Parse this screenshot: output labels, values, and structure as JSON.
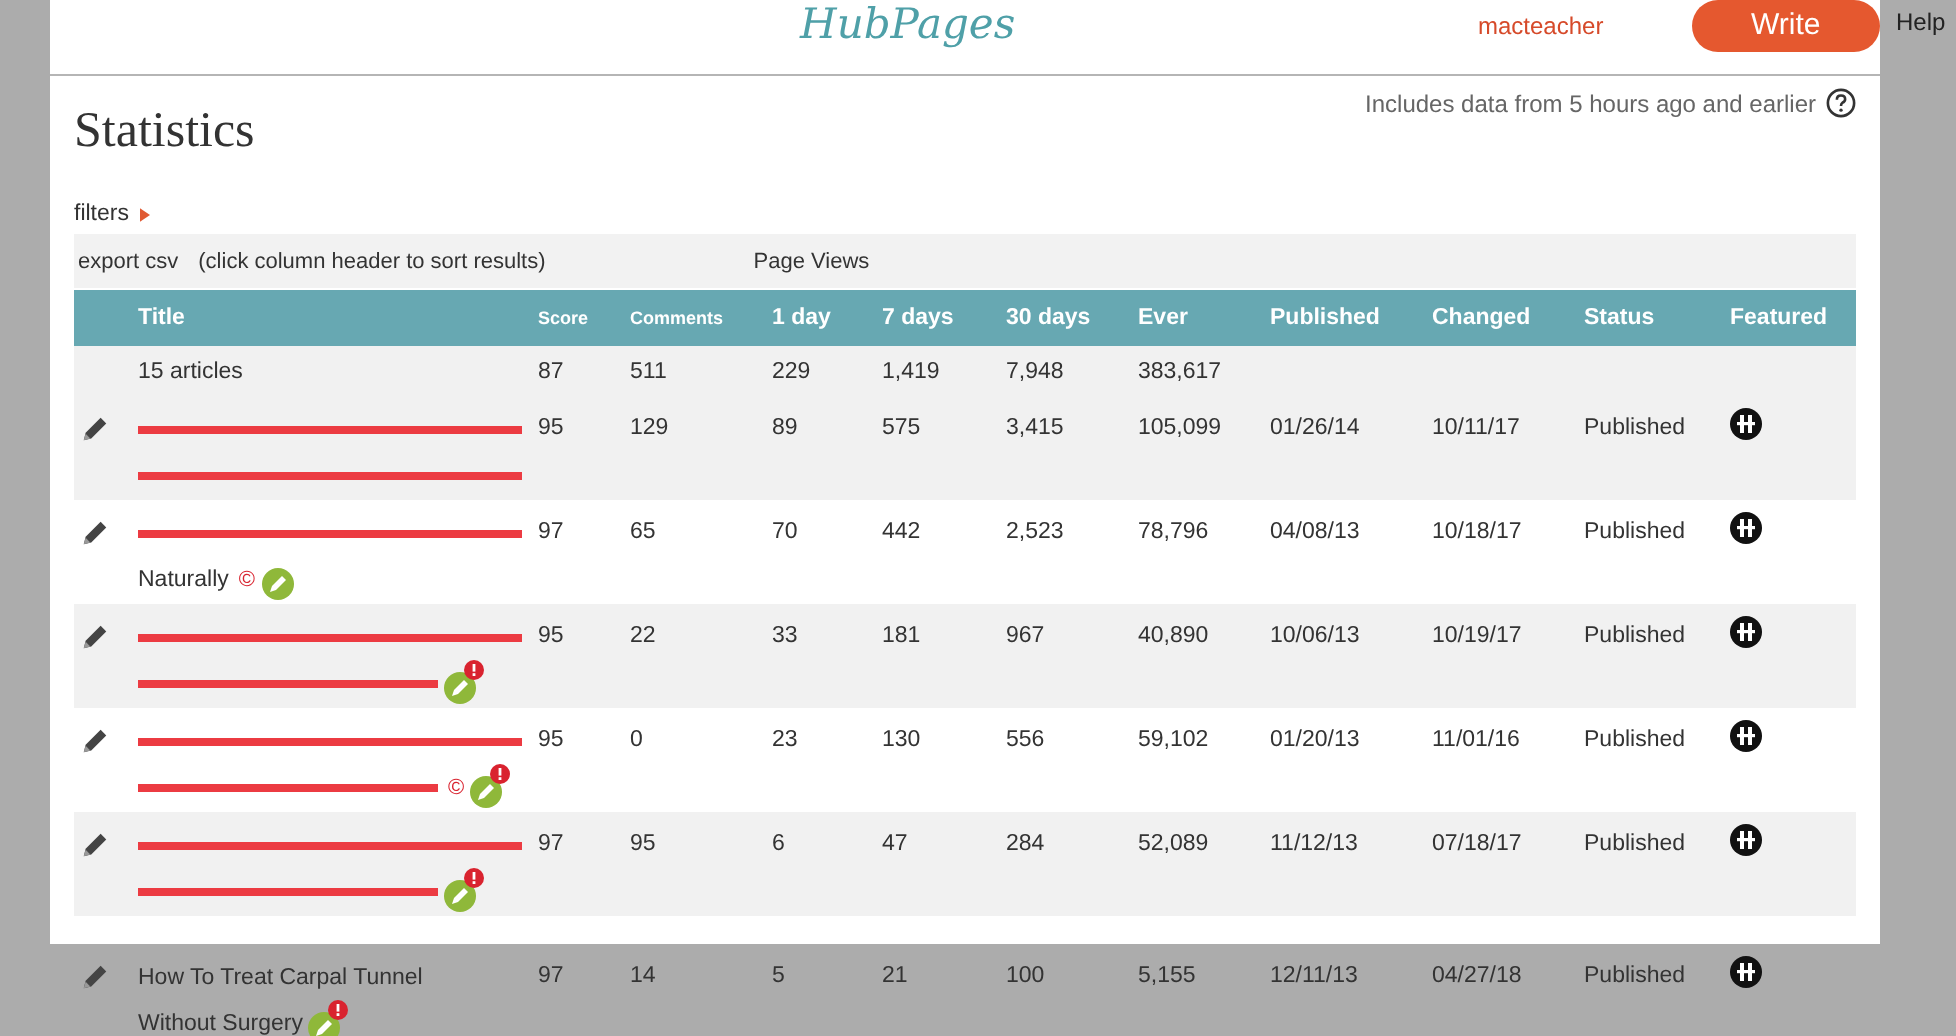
{
  "header": {
    "logo": "HubPages",
    "user": "macteacher",
    "write_button": "Write",
    "help": "Help"
  },
  "page": {
    "title": "Statistics",
    "data_note": "Includes data from 5 hours ago and earlier",
    "filters_label": "filters",
    "export_link": "export csv",
    "sort_hint": "(click column header to sort results)",
    "group_heading": "Page Views"
  },
  "table": {
    "columns": [
      "Title",
      "Score",
      "Comments",
      "1 day",
      "7 days",
      "30 days",
      "Ever",
      "Published",
      "Changed",
      "Status",
      "Featured"
    ],
    "summary": {
      "title": "15 articles",
      "score": "87",
      "comments": "511",
      "day1": "229",
      "days7": "1,419",
      "days30": "7,948",
      "ever": "383,617"
    },
    "rows": [
      {
        "title_lines": [
          {
            "redacted": true
          },
          {
            "redacted": true
          }
        ],
        "score": "95",
        "comments": "129",
        "day1": "89",
        "days7": "575",
        "days30": "3,415",
        "ever": "105,099",
        "published": "01/26/14",
        "changed": "10/11/17",
        "status": "Published",
        "featured": true
      },
      {
        "title_lines": [
          {
            "redacted": true
          },
          {
            "redacted": false,
            "text": "Naturally"
          }
        ],
        "copyright_mark": "©",
        "edit_badge": true,
        "score": "97",
        "comments": "65",
        "day1": "70",
        "days7": "442",
        "days30": "2,523",
        "ever": "78,796",
        "published": "04/08/13",
        "changed": "10/18/17",
        "status": "Published",
        "featured": true
      },
      {
        "title_lines": [
          {
            "redacted": true
          },
          {
            "redacted": true
          }
        ],
        "edit_badge": true,
        "badge_alert": true,
        "score": "95",
        "comments": "22",
        "day1": "33",
        "days7": "181",
        "days30": "967",
        "ever": "40,890",
        "published": "10/06/13",
        "changed": "10/19/17",
        "status": "Published",
        "featured": true
      },
      {
        "title_lines": [
          {
            "redacted": true
          },
          {
            "redacted": true
          }
        ],
        "copyright_mark": "©",
        "edit_badge": true,
        "badge_alert": true,
        "score": "95",
        "comments": "0",
        "day1": "23",
        "days7": "130",
        "days30": "556",
        "ever": "59,102",
        "published": "01/20/13",
        "changed": "11/01/16",
        "status": "Published",
        "featured": true
      },
      {
        "title_lines": [
          {
            "redacted": true
          },
          {
            "redacted": true
          }
        ],
        "edit_badge": true,
        "badge_alert": true,
        "score": "97",
        "comments": "95",
        "day1": "6",
        "days7": "47",
        "days30": "284",
        "ever": "52,089",
        "published": "11/12/13",
        "changed": "07/18/17",
        "status": "Published",
        "featured": true
      }
    ],
    "rows_below_panel": [
      {
        "title_lines": [
          {
            "redacted": false,
            "text": "How To Treat Carpal Tunnel"
          },
          {
            "redacted": false,
            "text": "Without Surgery"
          }
        ],
        "edit_badge": true,
        "badge_alert": true,
        "score": "97",
        "comments": "14",
        "day1": "5",
        "days7": "21",
        "days30": "100",
        "ever": "5,155",
        "published": "12/11/13",
        "changed": "04/27/18",
        "status": "Published",
        "featured": true
      }
    ]
  }
}
